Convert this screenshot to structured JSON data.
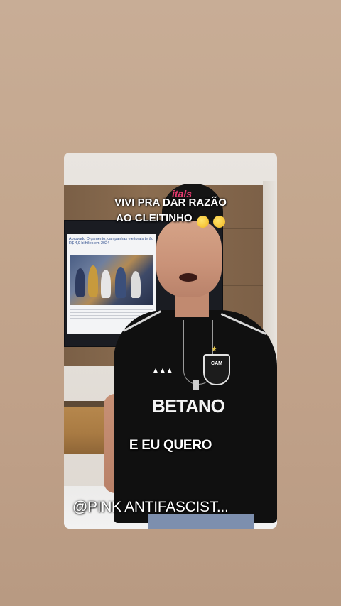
{
  "overlay": {
    "caption_top_line1": "VIVI PRA DAR RAZÃO",
    "caption_top_line2": "AO CLEITINHO",
    "caption_top_emojis": [
      "face-with-hand-over-mouth",
      "rolling-on-floor-laughing"
    ],
    "caption_middle": "E EU QUERO",
    "caption_bottom": "@PINK ANTIFASCIST..."
  },
  "tv": {
    "headline": "Aprovado Orçamento; campanhas eleitorais terão R$ 4,9 bilhões em 2024"
  },
  "shirt": {
    "sponsor": "BETANO",
    "crest": "CAM",
    "cap_text": "itals"
  },
  "colors": {
    "background": "#c4a78e",
    "caption_text": "#ffffff",
    "shirt": "#101010"
  }
}
